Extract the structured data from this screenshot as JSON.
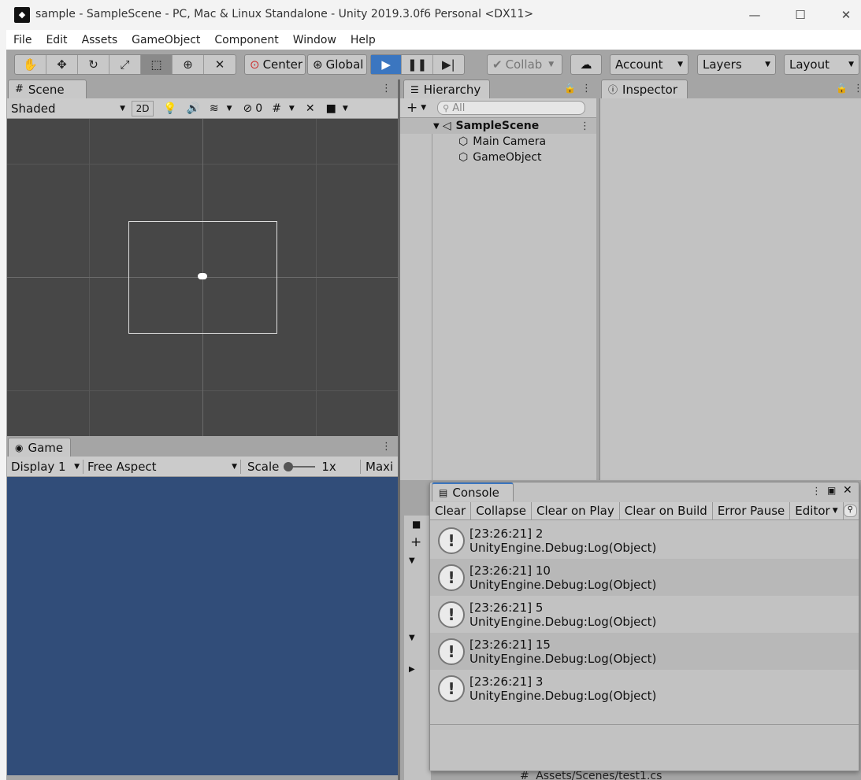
{
  "window": {
    "title": "sample - SampleScene - PC, Mac & Linux Standalone - Unity 2019.3.0f6 Personal <DX11>",
    "minimize": "—",
    "maximize": "☐",
    "close": "✕"
  },
  "menubar": [
    "File",
    "Edit",
    "Assets",
    "GameObject",
    "Component",
    "Window",
    "Help"
  ],
  "toolbar": {
    "pivot": "Center",
    "space": "Global",
    "collab": "Collab",
    "account": "Account",
    "layers": "Layers",
    "layout": "Layout",
    "dropdown_arrow": "▼"
  },
  "scene": {
    "tab": "Scene",
    "shading": "Shaded",
    "mode_2d": "2D",
    "hidden_count": "0"
  },
  "game": {
    "tab": "Game",
    "display": "Display 1",
    "aspect": "Free Aspect",
    "scale_label": "Scale",
    "scale_value": "1x",
    "maximize": "Maxi",
    "bg_color": "#314d79"
  },
  "hierarchy": {
    "tab": "Hierarchy",
    "search_placeholder": "All",
    "scene_name": "SampleScene",
    "items": [
      "Main Camera",
      "GameObject"
    ]
  },
  "inspector": {
    "tab": "Inspector"
  },
  "console": {
    "tab": "Console",
    "buttons": [
      "Clear",
      "Collapse",
      "Clear on Play",
      "Clear on Build",
      "Error Pause",
      "Editor"
    ],
    "logs": [
      {
        "line1": "[23:26:21] 2",
        "line2": "UnityEngine.Debug:Log(Object)"
      },
      {
        "line1": "[23:26:21] 10",
        "line2": "UnityEngine.Debug:Log(Object)"
      },
      {
        "line1": "[23:26:21] 5",
        "line2": "UnityEngine.Debug:Log(Object)"
      },
      {
        "line1": "[23:26:21] 15",
        "line2": "UnityEngine.Debug:Log(Object)"
      },
      {
        "line1": "[23:26:21] 3",
        "line2": "UnityEngine.Debug:Log(Object)"
      }
    ]
  },
  "project": {
    "file_path": "Assets/Scenes/test1.cs"
  }
}
